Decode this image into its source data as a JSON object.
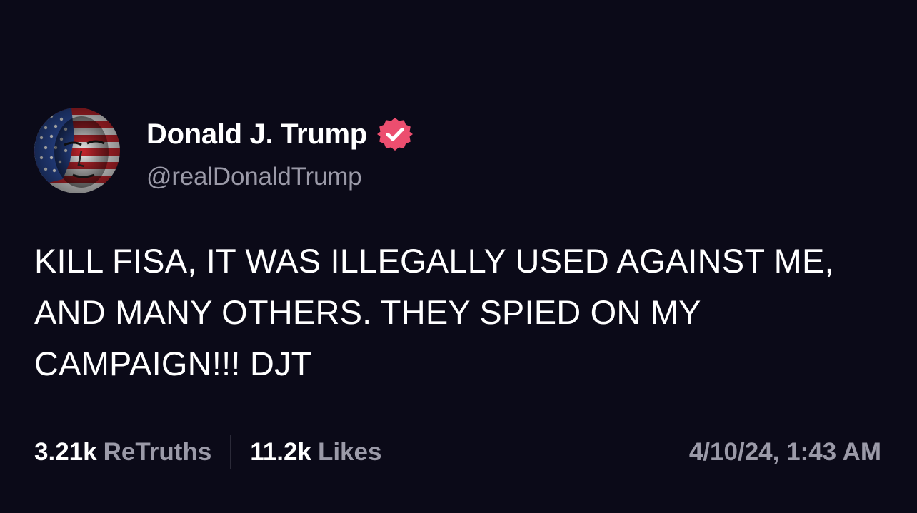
{
  "colors": {
    "background": "#0b0a18",
    "primary_text": "#ffffff",
    "secondary_text": "#9b9aa8",
    "verified_badge": "#ec4e6f",
    "divider": "#2b2a38"
  },
  "author": {
    "avatar_icon": "flag-portrait-avatar",
    "display_name": "Donald J. Trump",
    "verified_icon": "verified-badge-icon",
    "handle": "@realDonaldTrump"
  },
  "post": {
    "text": "KILL FISA, IT WAS ILLEGALLY USED AGAINST ME, AND MANY OTHERS. THEY SPIED ON MY CAMPAIGN!!! DJT"
  },
  "stats": {
    "retruths_count": "3.21k",
    "retruths_label": "ReTruths",
    "likes_count": "11.2k",
    "likes_label": "Likes"
  },
  "timestamp": "4/10/24, 1:43 AM"
}
